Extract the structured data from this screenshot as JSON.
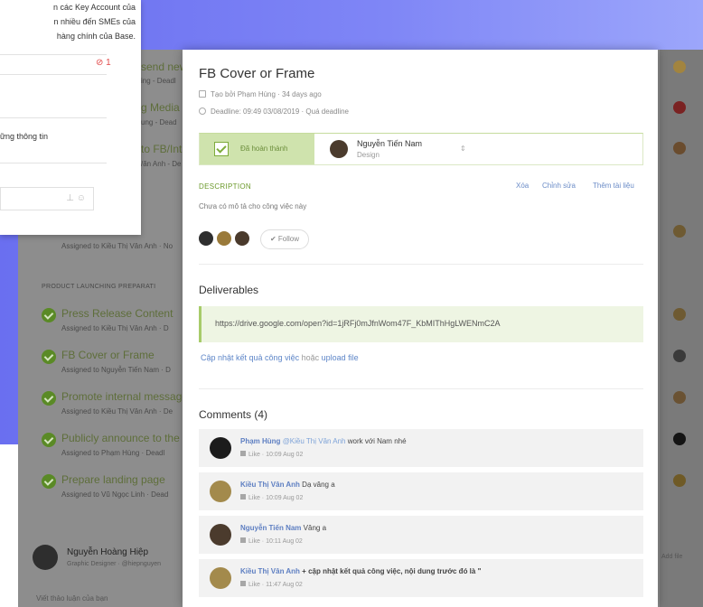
{
  "colors": {
    "accent_blue": "#6a6ff0",
    "done_green": "#cfe3ad",
    "link_blue": "#5e86c8",
    "author_blue": "#5e7fc2"
  },
  "popup": {
    "text_lines": [
      "n các Key Account của",
      "n nhiều đến SMEs của",
      "hàng chính của Base."
    ],
    "notification": "1",
    "info": "ững thông tin"
  },
  "tasklist": {
    "tasks_top": [
      {
        "title": "send new",
        "sub": "ing - Deadl"
      },
      {
        "title": "g Media P",
        "sub": "ung - Dead"
      },
      {
        "title": "to FB/Int",
        "sub": "/ăn Anh - De"
      }
    ],
    "assigned_row": {
      "sub": "Assigned to Kiều Thị Vân Anh · No"
    },
    "section": "PRODUCT LAUNCHING PREPARATI",
    "tasks": [
      {
        "title": "Press Release Content",
        "sub": "Assigned to Kiều Thị Vân Anh · D"
      },
      {
        "title": "FB Cover or Frame",
        "sub": "Assigned to Nguyễn Tiến Nam · D"
      },
      {
        "title": "Promote internal message",
        "sub": "Assigned to Kiều Thị Vân Anh · De"
      },
      {
        "title": "Publicly announce to the c",
        "sub": "Assigned to Phạm Hùng · Deadl"
      },
      {
        "title": "Prepare landing page",
        "sub": "Assigned to Vũ Ngọc Linh · Dead"
      }
    ]
  },
  "bottom_user": {
    "name": "Nguyễn Hoàng Hiệp",
    "role": "Graphic Designer · @hiepnguyen",
    "input_placeholder": "Viết thảo luận của bạn",
    "add_file": "Add file"
  },
  "modal": {
    "title": "FB Cover or Frame",
    "created": "Tạo bởi Phạm Hùng · 34 days ago",
    "deadline": "Deadline: 09:49 03/08/2019 · Quá deadline",
    "status_label": "Đã hoàn thành",
    "assignee_name": "Nguyễn Tiến Nam",
    "assignee_role": "Design",
    "description_label": "DESCRIPTION",
    "desc_actions": [
      "Xóa",
      "Chỉnh sửa",
      "Thêm tài liệu"
    ],
    "description_text": "Chưa có mô tả cho công việc này",
    "follow_label": "Follow",
    "deliverables_title": "Deliverables",
    "deliverable_url": "https://drive.google.com/open?id=1jRFj0mJfnWom47F_KbMIThHgLWENmC2A",
    "update_text": "Cập nhật kết quả công việc",
    "update_or": "hoặc",
    "upload_text": "upload file",
    "comments_title": "Comments (4)",
    "like_label": "Like",
    "comments": [
      {
        "author": "Phạm Hùng",
        "mention": "@Kiều Thị Vân Anh",
        "text": "work với Nam nhé",
        "time": "10:09 Aug 02"
      },
      {
        "author": "Kiều Thị Vân Anh",
        "mention": "",
        "text": "Dạ vâng a",
        "time": "10:09 Aug 02"
      },
      {
        "author": "Nguyễn Tiến Nam",
        "mention": "",
        "text": "Vâng a",
        "time": "10:11 Aug 02"
      },
      {
        "author": "Kiều Thị Vân Anh",
        "mention": "",
        "text": "+ cập nhật kết quả công việc, nội dung trước đó là \"",
        "time": "11:47 Aug 02"
      }
    ]
  }
}
